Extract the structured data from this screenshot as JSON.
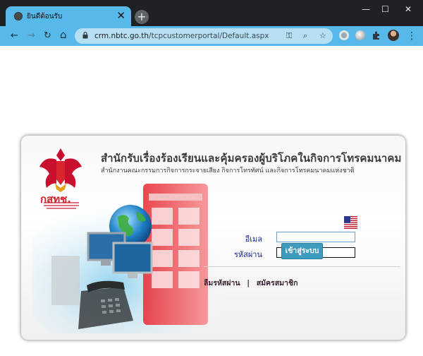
{
  "browser": {
    "tab_title": "ยินดีต้อนรับ",
    "tab_close": "✕",
    "new_tab": "+",
    "url_host": "crm.nbtc.go.th",
    "url_path": "/tcpcustomerportal/Default.aspx",
    "window_controls": {
      "minimize": "—",
      "maximize": "☐",
      "close": "✕"
    },
    "nav": {
      "back": "←",
      "forward": "→",
      "reload": "↻",
      "home": "⌂"
    },
    "omnibox_icons": {
      "key": "⚿",
      "zoom": "⌕",
      "star": "☆"
    },
    "menu": "⋮",
    "accent_color": "#56b9e9"
  },
  "portal": {
    "headline": "สำนักรับเรื่องร้องเรียนและคุ้มครองผู้บริโภคในกิจการโทรคมนาคม",
    "subhead": "สำนักงานคณะกรรมการกิจการกระจายเสียง กิจการโทรทัศน์ และกิจการโทรคมนาคมแห่งชาติ",
    "brand": "กสทช."
  },
  "login": {
    "email_label": "อีเมล",
    "password_label": "รหัสผ่าน",
    "email_value": "",
    "password_value": "",
    "submit_label": "เข้าสู่ระบบ",
    "language_flag": "us-flag-icon"
  },
  "links": {
    "forgot_password": "ลืมรหัสผ่าน",
    "separator": "|",
    "register": "สมัครสมาชิก"
  }
}
